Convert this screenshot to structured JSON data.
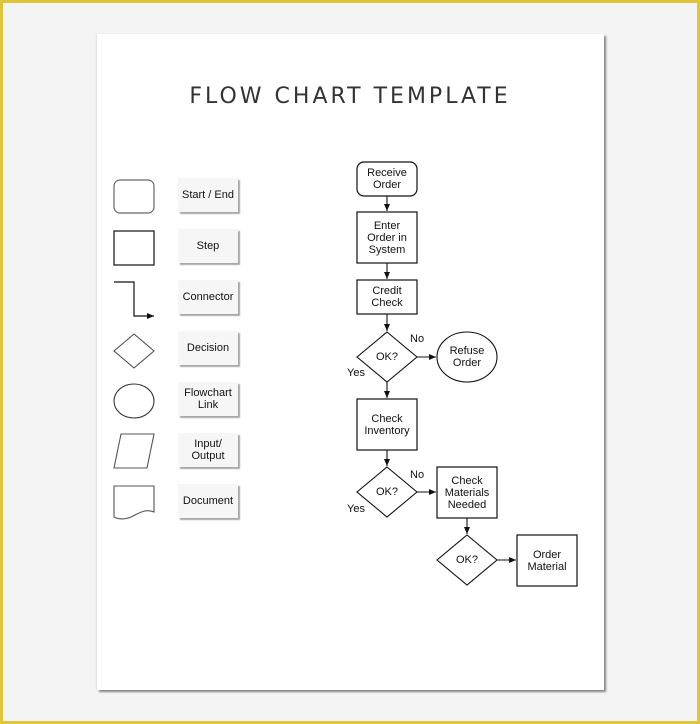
{
  "document": {
    "title": "FLOW CHART TEMPLATE"
  },
  "legend": {
    "items": [
      {
        "shape": "rounded-rectangle",
        "label": "Start / End"
      },
      {
        "shape": "rectangle",
        "label": "Step"
      },
      {
        "shape": "elbow-arrow",
        "label": "Connector"
      },
      {
        "shape": "diamond",
        "label": "Decision"
      },
      {
        "shape": "ellipse",
        "label": "Flowchart\nLink"
      },
      {
        "shape": "parallelogram",
        "label": "Input/\nOutput"
      },
      {
        "shape": "document",
        "label": "Document"
      }
    ]
  },
  "flowchart": {
    "nodes": [
      {
        "id": "receive",
        "type": "terminator",
        "label": "Receive\nOrder"
      },
      {
        "id": "enter",
        "type": "process",
        "label": "Enter\nOrder in\nSystem"
      },
      {
        "id": "credit",
        "type": "process",
        "label": "Credit\nCheck"
      },
      {
        "id": "ok1",
        "type": "decision",
        "label": "OK?"
      },
      {
        "id": "refuse",
        "type": "link",
        "label": "Refuse\nOrder"
      },
      {
        "id": "inventory",
        "type": "process",
        "label": "Check\nInventory"
      },
      {
        "id": "ok2",
        "type": "decision",
        "label": "OK?"
      },
      {
        "id": "materials",
        "type": "process",
        "label": "Check\nMaterials\nNeeded"
      },
      {
        "id": "ok3",
        "type": "decision",
        "label": "OK?"
      },
      {
        "id": "order_material",
        "type": "process",
        "label": "Order\nMaterial"
      }
    ],
    "edges": [
      {
        "from": "receive",
        "to": "enter",
        "label": ""
      },
      {
        "from": "enter",
        "to": "credit",
        "label": ""
      },
      {
        "from": "credit",
        "to": "ok1",
        "label": ""
      },
      {
        "from": "ok1",
        "to": "refuse",
        "label": "No"
      },
      {
        "from": "ok1",
        "to": "inventory",
        "label": "Yes"
      },
      {
        "from": "inventory",
        "to": "ok2",
        "label": ""
      },
      {
        "from": "ok2",
        "to": "materials",
        "label": "No"
      },
      {
        "from": "ok2",
        "to": "",
        "label": "Yes"
      },
      {
        "from": "materials",
        "to": "ok3",
        "label": ""
      },
      {
        "from": "ok3",
        "to": "order_material",
        "label": ""
      }
    ]
  },
  "colors": {
    "frame": "#e0c43a",
    "background": "#f4f4f4",
    "page": "#ffffff",
    "stroke": "#111111",
    "legend_stroke": "#555555",
    "title": "#333333"
  }
}
